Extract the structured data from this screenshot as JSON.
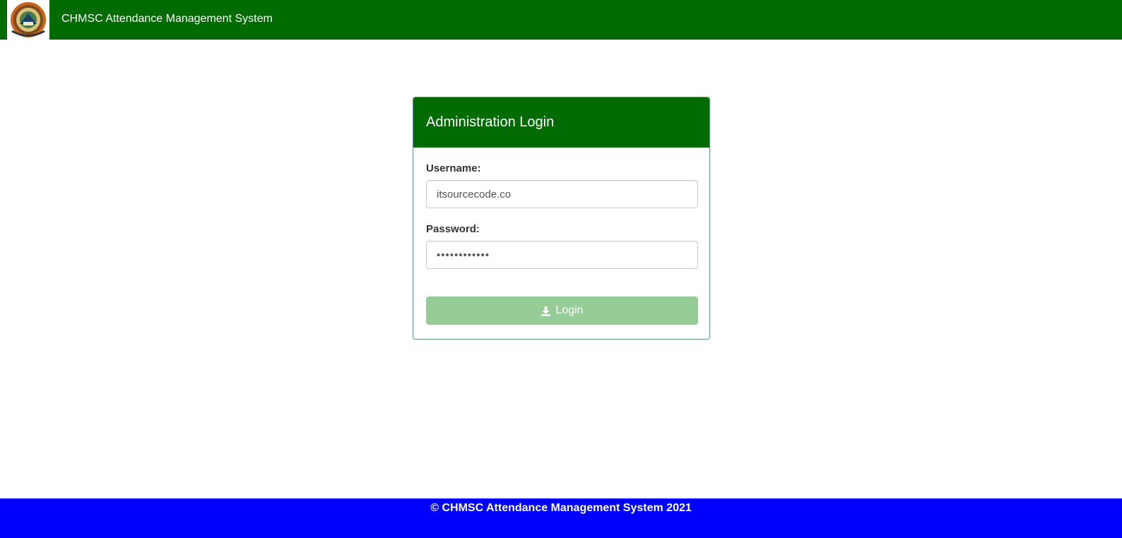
{
  "header": {
    "logo_icon": "school-seal-logo",
    "title": "CHMSC Attendance Management System",
    "background": "#006b00"
  },
  "login_panel": {
    "title": "Administration Login",
    "username": {
      "label": "Username:",
      "value": "itsourcecode.co"
    },
    "password": {
      "label": "Password:",
      "value": "••••••••••••"
    },
    "login_button": {
      "label": "Login",
      "icon": "download-icon",
      "color": "#96cc96"
    }
  },
  "footer": {
    "text": "© CHMSC Attendance Management System 2021",
    "background": "#0000ff"
  }
}
